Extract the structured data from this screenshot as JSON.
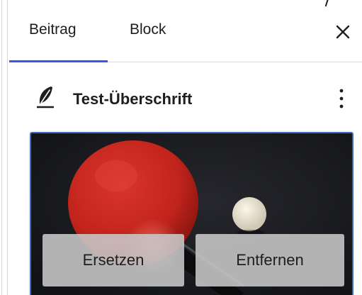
{
  "tabs": [
    {
      "label": "Beitrag",
      "active": true
    },
    {
      "label": "Block",
      "active": false
    }
  ],
  "close_icon": "close-icon",
  "block": {
    "icon": "feather-icon",
    "title": "Test-Überschrift",
    "more_icon": "more-vertical-icon"
  },
  "image": {
    "subject": "table-tennis-paddle-and-ball",
    "replace_label": "Ersetzen",
    "remove_label": "Entfernen"
  },
  "colors": {
    "accent": "#3858e9",
    "selection_border": "#3a6fb5",
    "paddle": "#c8261f",
    "photo_background": "#1c1d21"
  }
}
